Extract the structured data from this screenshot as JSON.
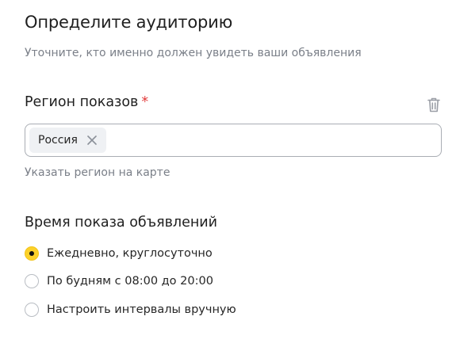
{
  "header": {
    "title": "Определите аудиторию",
    "subtitle": "Уточните, кто именно должен увидеть ваши объявления"
  },
  "region": {
    "label": "Регион показов",
    "required_mark": "*",
    "selected_chip": "Россия",
    "chip_remove_icon": "close-icon",
    "delete_icon": "trash-icon",
    "map_link": "Указать регион на карте"
  },
  "schedule": {
    "label": "Время показа объявлений",
    "options": [
      {
        "label": "Ежедневно, круглосуточно",
        "checked": true
      },
      {
        "label": "По будням с 08:00 до 20:00",
        "checked": false
      },
      {
        "label": "Настроить интервалы вручную",
        "checked": false
      }
    ]
  },
  "colors": {
    "accent": "#fcd12a",
    "required": "#e23b3b",
    "muted_text": "#7a7f88",
    "border": "#a9adb4",
    "chip_bg": "#eff1f4"
  }
}
